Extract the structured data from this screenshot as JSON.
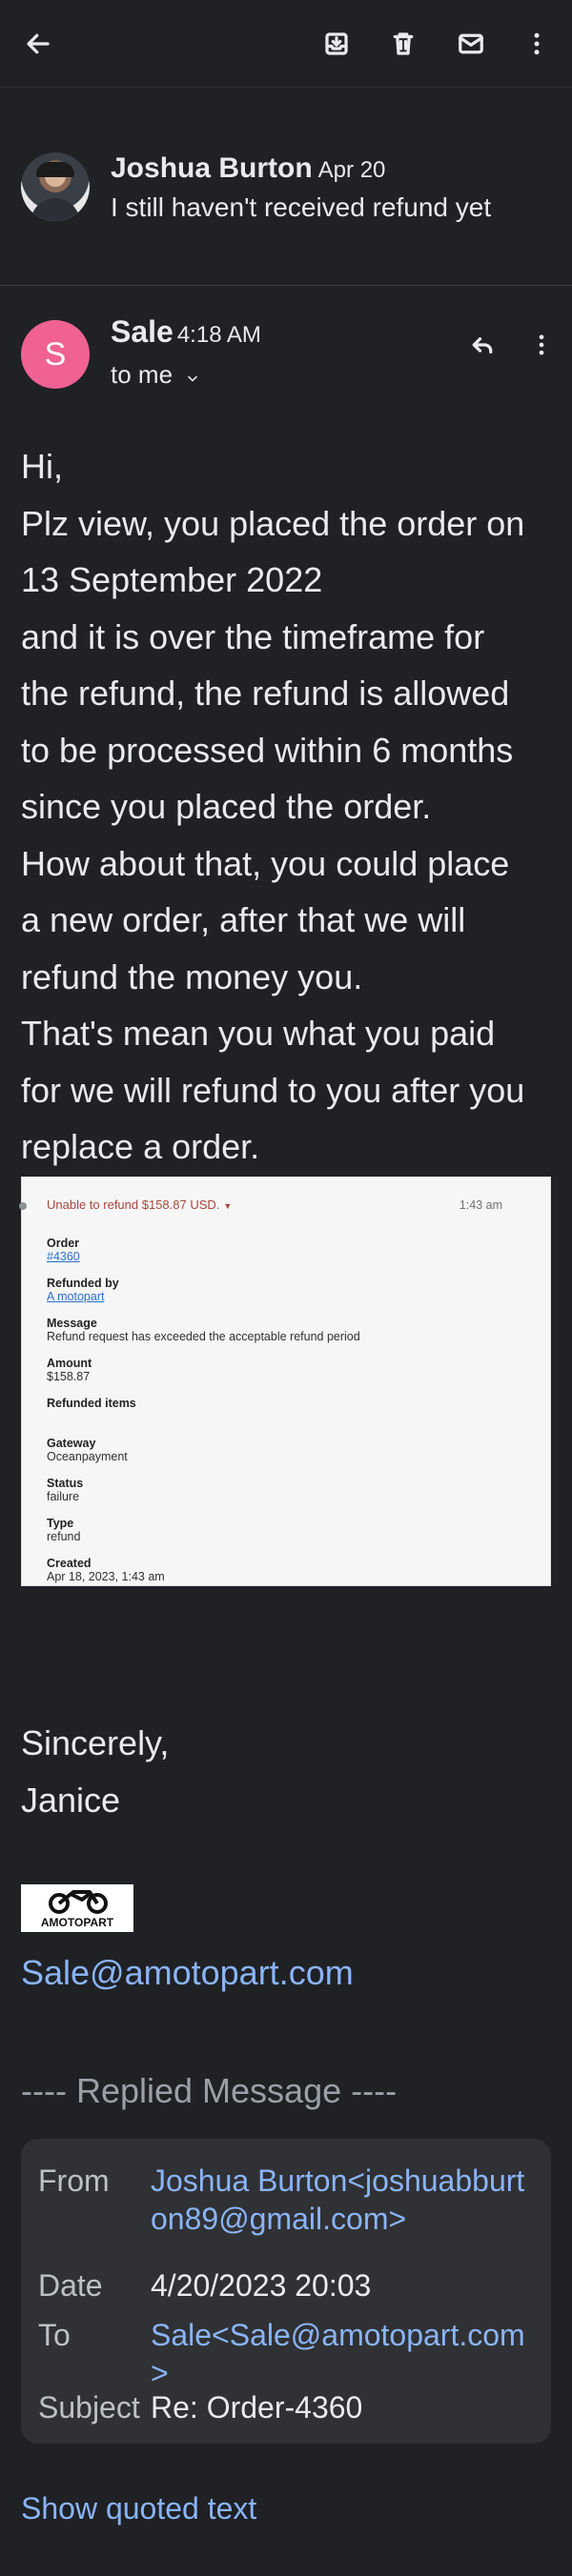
{
  "toolbar": {
    "back_icon": "arrow-left-icon",
    "archive_icon": "archive-icon",
    "delete_icon": "trash-icon",
    "mark_unread_icon": "mail-icon",
    "more_icon": "more-vert-icon"
  },
  "thread_item": {
    "sender": "Joshua Burton",
    "date": "Apr 20",
    "snippet": "I still haven't received refund yet"
  },
  "message": {
    "avatar_letter": "S",
    "avatar_color": "#f06292",
    "sender": "Sale",
    "time": "4:18 AM",
    "to_label": "to me",
    "body_lines": [
      "Hi,",
      "Plz view, you placed the order on",
      "13 September 2022",
      "and it is over the timeframe for",
      "the refund, the refund is allowed",
      "to be processed within 6 months",
      "since you placed the order.",
      "How about that, you could place",
      "a new order, after that we will",
      "refund the money you.",
      "That's mean you what you paid",
      "for we will refund to you after you",
      "replace a order."
    ]
  },
  "embedded_screenshot": {
    "status": "Unable to refund $158.87 USD.",
    "time": "1:43 am",
    "fields": [
      {
        "label": "Order",
        "value": "#4360",
        "link": true
      },
      {
        "label": "Refunded by",
        "value": "A motopart",
        "link": true
      },
      {
        "label": "Message",
        "value": "Refund request has exceeded the acceptable refund period",
        "link": false
      },
      {
        "label": "Amount",
        "value": "$158.87",
        "link": false
      },
      {
        "label": "Refunded items",
        "value": "",
        "link": false
      },
      {
        "label": "Gateway",
        "value": "Oceanpayment",
        "link": false
      },
      {
        "label": "Status",
        "value": "failure",
        "link": false
      },
      {
        "label": "Type",
        "value": "refund",
        "link": false
      },
      {
        "label": "Created",
        "value": "Apr 18, 2023, 1:43 am",
        "link": false
      }
    ]
  },
  "signature": {
    "closing": "Sincerely,",
    "name": "Janice",
    "logo_text": "AMOTOPART",
    "email": "Sale@amotopart.com"
  },
  "replied_message": {
    "header": "---- Replied Message ----",
    "from_label": "From",
    "from_value": "Joshua Burton<joshuabburton89@gmail.com>",
    "date_label": "Date",
    "date_value": "4/20/2023 20:03",
    "to_label": "To",
    "to_value": "Sale<Sale@amotopart.com>",
    "subject_label": "Subject",
    "subject_value": "Re: Order-4360"
  },
  "show_quoted_text": "Show quoted text"
}
